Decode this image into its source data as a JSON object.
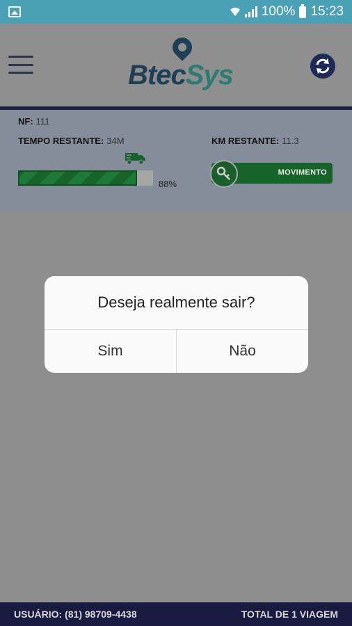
{
  "status_bar": {
    "battery": "100%",
    "time": "15:23",
    "icons": [
      "image-icon",
      "wifi-icon",
      "signal-icon",
      "battery-icon"
    ]
  },
  "header": {
    "logo_part1": "Btec",
    "logo_part2": "Sys",
    "menu_icon": "hamburger-menu-icon",
    "refresh_icon": "refresh-icon"
  },
  "info": {
    "nf_label": "NF:",
    "nf_value": "111",
    "tempo_label": "TEMPO RESTANTE:",
    "tempo_value": "34M",
    "km_label": "KM RESTANTE:",
    "km_value": "11.3",
    "progress_percent": 88,
    "progress_text": "88%",
    "toggle_label": "MOVIMENTO",
    "toggle_icon": "key-icon",
    "truck_icon": "truck-icon"
  },
  "dialog": {
    "title": "Deseja realmente sair?",
    "yes_label": "Sim",
    "no_label": "Não"
  },
  "footer": {
    "user": "USUÁRIO: (81) 98709-4438",
    "total": "TOTAL DE 1 VIAGEM"
  },
  "colors": {
    "status_bar": "#4aa0b5",
    "nav_dark": "#1b1f4a",
    "progress_green": "#1d7a36",
    "overlay_gray": "#8e8e8e"
  }
}
